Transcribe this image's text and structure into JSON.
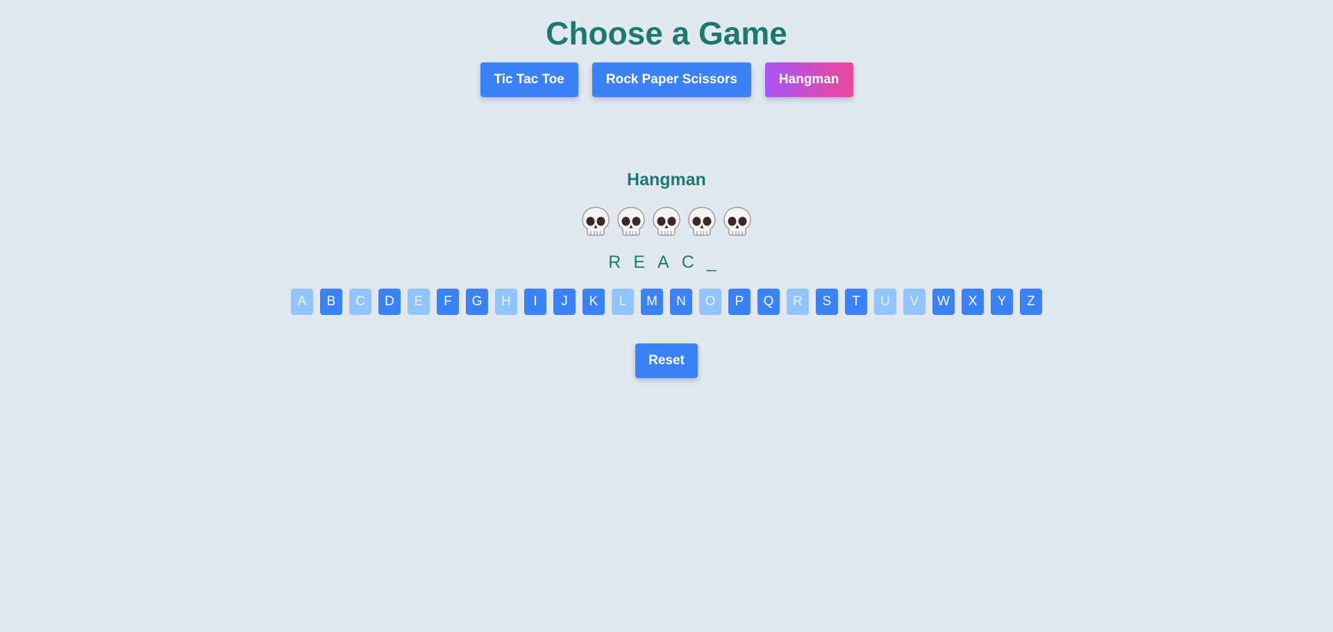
{
  "page": {
    "title": "Choose a Game"
  },
  "nav": {
    "items": [
      {
        "label": "Tic Tac Toe",
        "active": false
      },
      {
        "label": "Rock Paper Scissors",
        "active": false
      },
      {
        "label": "Hangman",
        "active": true
      }
    ]
  },
  "game": {
    "heading": "Hangman",
    "lives_icon": "skull-icon",
    "lives_remaining": 5,
    "word_display": [
      "R",
      "E",
      "A",
      "C",
      "_"
    ],
    "letters": [
      {
        "label": "A",
        "used": true
      },
      {
        "label": "B",
        "used": false
      },
      {
        "label": "C",
        "used": true
      },
      {
        "label": "D",
        "used": false
      },
      {
        "label": "E",
        "used": true
      },
      {
        "label": "F",
        "used": false
      },
      {
        "label": "G",
        "used": false
      },
      {
        "label": "H",
        "used": true
      },
      {
        "label": "I",
        "used": false
      },
      {
        "label": "J",
        "used": false
      },
      {
        "label": "K",
        "used": false
      },
      {
        "label": "L",
        "used": true
      },
      {
        "label": "M",
        "used": false
      },
      {
        "label": "N",
        "used": false
      },
      {
        "label": "O",
        "used": true
      },
      {
        "label": "P",
        "used": false
      },
      {
        "label": "Q",
        "used": false
      },
      {
        "label": "R",
        "used": true
      },
      {
        "label": "S",
        "used": false
      },
      {
        "label": "T",
        "used": false
      },
      {
        "label": "U",
        "used": true
      },
      {
        "label": "V",
        "used": true
      },
      {
        "label": "W",
        "used": false
      },
      {
        "label": "X",
        "used": false
      },
      {
        "label": "Y",
        "used": false
      },
      {
        "label": "Z",
        "used": false
      }
    ],
    "reset_label": "Reset"
  },
  "colors": {
    "background": "#e2e8f0",
    "heading": "#1b7a70",
    "button": "#3b82f6",
    "button_used": "#93c5fd",
    "active_gradient_start": "#a855f7",
    "active_gradient_end": "#ec4899"
  }
}
